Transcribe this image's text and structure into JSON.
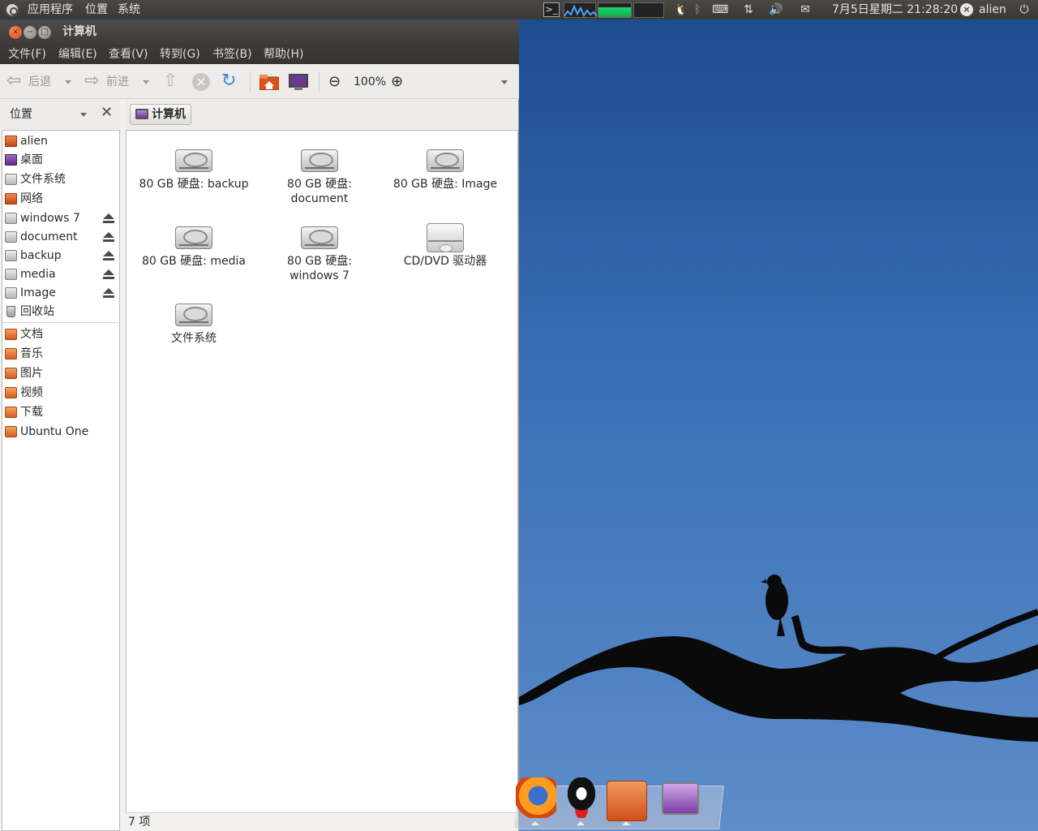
{
  "top_panel": {
    "menus": [
      "应用程序",
      "位置",
      "系统"
    ],
    "clock": "7月5日星期二 21:28:20",
    "user": "alien",
    "icons": [
      "ubuntu-logo-icon",
      "terminal-icon",
      "cpu-graph-icon",
      "memory-graph-icon",
      "qq-icon",
      "bluetooth-icon",
      "keyboard-icon",
      "network-icon",
      "volume-icon",
      "mail-icon",
      "user-status-icon",
      "power-icon"
    ]
  },
  "window": {
    "title": "计算机",
    "menu": [
      "文件(F)",
      "编辑(E)",
      "查看(V)",
      "转到(G)",
      "书签(B)",
      "帮助(H)"
    ],
    "toolbar": {
      "back": "后退",
      "forward": "前进",
      "zoom": "100%"
    },
    "sidebar": {
      "header": "位置",
      "places": [
        {
          "label": "alien",
          "icon": "home-icon",
          "eject": false
        },
        {
          "label": "桌面",
          "icon": "desktop-icon",
          "eject": false
        },
        {
          "label": "文件系统",
          "icon": "drive-icon",
          "eject": false
        },
        {
          "label": "网络",
          "icon": "network-icon",
          "eject": false
        },
        {
          "label": "windows 7",
          "icon": "drive-icon",
          "eject": true
        },
        {
          "label": "document",
          "icon": "drive-icon",
          "eject": true
        },
        {
          "label": "backup",
          "icon": "drive-icon",
          "eject": true
        },
        {
          "label": "media",
          "icon": "drive-icon",
          "eject": true
        },
        {
          "label": "Image",
          "icon": "drive-icon",
          "eject": true
        },
        {
          "label": "回收站",
          "icon": "trash-icon",
          "eject": false
        }
      ],
      "bookmarks": [
        {
          "label": "文档",
          "icon": "folder-icon"
        },
        {
          "label": "音乐",
          "icon": "folder-icon"
        },
        {
          "label": "图片",
          "icon": "folder-icon"
        },
        {
          "label": "视频",
          "icon": "folder-icon"
        },
        {
          "label": "下载",
          "icon": "folder-icon"
        },
        {
          "label": "Ubuntu One",
          "icon": "folder-icon"
        }
      ]
    },
    "pathbar": {
      "current": "计算机"
    },
    "items": [
      {
        "label": "80 GB 硬盘: backup",
        "icon": "hard-drive-icon"
      },
      {
        "label": "80 GB 硬盘:\ndocument",
        "icon": "hard-drive-icon"
      },
      {
        "label": "80 GB 硬盘: Image",
        "icon": "hard-drive-icon"
      },
      {
        "label": "80 GB 硬盘: media",
        "icon": "hard-drive-icon"
      },
      {
        "label": "80 GB 硬盘:\nwindows 7",
        "icon": "hard-drive-icon"
      },
      {
        "label": "CD/DVD 驱动器",
        "icon": "optical-drive-icon"
      },
      {
        "label": "文件系统",
        "icon": "hard-drive-icon"
      }
    ],
    "status": "7 项"
  },
  "dock": {
    "icons": [
      "firefox-icon",
      "qq-icon",
      "home-folder-icon",
      "computer-icon"
    ]
  },
  "colors": {
    "accent": "#dd4814",
    "panel": "#3c3b37",
    "desktop": "#3a70b6"
  }
}
